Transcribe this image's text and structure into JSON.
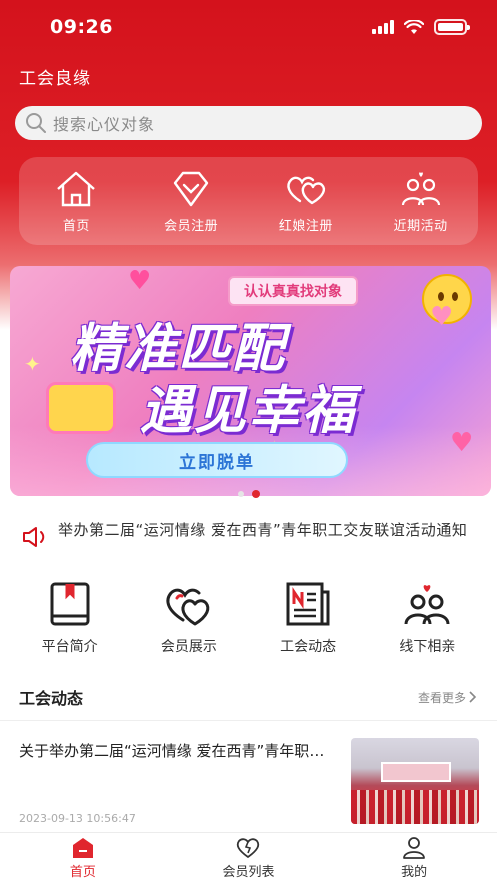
{
  "status_bar": {
    "time": "09:26"
  },
  "app": {
    "title": "工会良缘"
  },
  "search": {
    "placeholder": "搜索心仪对象"
  },
  "top_nav": [
    {
      "label": "首页",
      "icon": "home-icon"
    },
    {
      "label": "会员注册",
      "icon": "member-register-icon"
    },
    {
      "label": "红娘注册",
      "icon": "matchmaker-hearts-icon"
    },
    {
      "label": "近期活动",
      "icon": "couple-activity-icon"
    }
  ],
  "banner": {
    "tag": "认认真真找对象",
    "line1": "精准匹配",
    "line2": "遇见幸福",
    "button": "立即脱单",
    "slide_count": 2,
    "active_slide": 2
  },
  "notice": {
    "icon": "speaker-icon",
    "text": "举办第二届“运河情缘 爱在西青”青年职工交友联谊活动通知"
  },
  "features": [
    {
      "label": "平台简介",
      "icon": "book-icon"
    },
    {
      "label": "会员展示",
      "icon": "double-heart-icon"
    },
    {
      "label": "工会动态",
      "icon": "newspaper-icon"
    },
    {
      "label": "线下相亲",
      "icon": "couple-icon"
    }
  ],
  "news_section": {
    "title": "工会动态",
    "more": "查看更多",
    "items": [
      {
        "title": "关于举办第二届“运河情缘 爱在西青”青年职工交友联谊活动的通知",
        "time": "2023-09-13 10:56:47"
      }
    ]
  },
  "tabbar": [
    {
      "label": "首页",
      "icon": "home-tab-icon",
      "active": true
    },
    {
      "label": "会员列表",
      "icon": "heart-list-icon",
      "active": false
    },
    {
      "label": "我的",
      "icon": "user-icon",
      "active": false
    }
  ],
  "colors": {
    "brand_red": "#d4121c",
    "accent_red": "#e0262e"
  }
}
